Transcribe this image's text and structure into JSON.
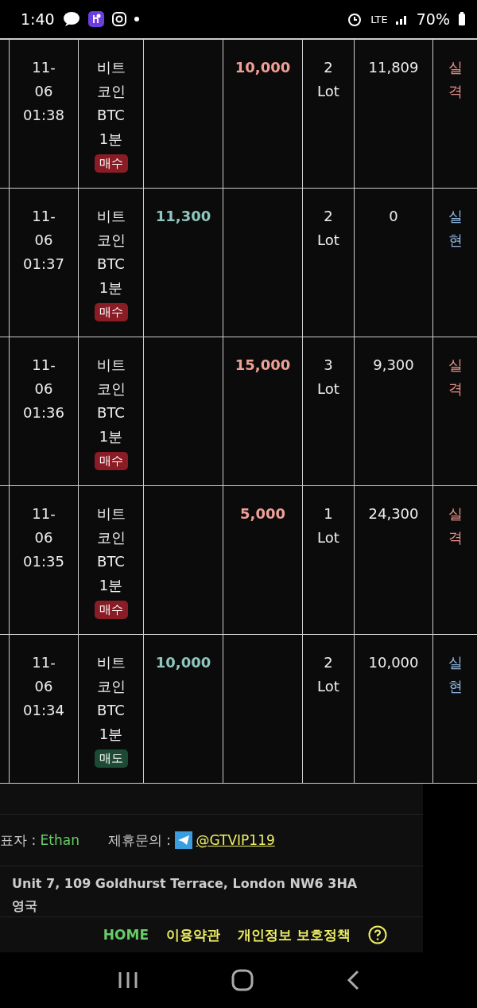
{
  "status_bar": {
    "time": "1:40",
    "network": "LTE",
    "battery": "70%"
  },
  "rows": [
    {
      "time": [
        "11-",
        "06",
        "01:38"
      ],
      "product": [
        "비트",
        "코인",
        "BTC",
        "1분"
      ],
      "side": {
        "kind": "buy",
        "label": "매수"
      },
      "profit": "",
      "loss": "10,000",
      "lots": [
        "2",
        "Lot"
      ],
      "amount": "11,809",
      "result": {
        "kind": "loss",
        "lines": [
          "실",
          "격"
        ]
      }
    },
    {
      "time": [
        "11-",
        "06",
        "01:37"
      ],
      "product": [
        "비트",
        "코인",
        "BTC",
        "1분"
      ],
      "side": {
        "kind": "buy",
        "label": "매수"
      },
      "profit": "11,300",
      "loss": "",
      "lots": [
        "2",
        "Lot"
      ],
      "amount": "0",
      "result": {
        "kind": "gain",
        "lines": [
          "실",
          "현"
        ]
      }
    },
    {
      "time": [
        "11-",
        "06",
        "01:36"
      ],
      "product": [
        "비트",
        "코인",
        "BTC",
        "1분"
      ],
      "side": {
        "kind": "buy",
        "label": "매수"
      },
      "profit": "",
      "loss": "15,000",
      "lots": [
        "3",
        "Lot"
      ],
      "amount": "9,300",
      "result": {
        "kind": "loss",
        "lines": [
          "실",
          "격"
        ]
      }
    },
    {
      "time": [
        "11-",
        "06",
        "01:35"
      ],
      "product": [
        "비트",
        "코인",
        "BTC",
        "1분"
      ],
      "side": {
        "kind": "buy",
        "label": "매수"
      },
      "profit": "",
      "loss": "5,000",
      "lots": [
        "1",
        "Lot"
      ],
      "amount": "24,300",
      "result": {
        "kind": "loss",
        "lines": [
          "실",
          "격"
        ]
      }
    },
    {
      "time": [
        "11-",
        "06",
        "01:34"
      ],
      "product": [
        "비트",
        "코인",
        "BTC",
        "1분"
      ],
      "side": {
        "kind": "sell",
        "label": "매도"
      },
      "profit": "10,000",
      "loss": "",
      "lots": [
        "2",
        "Lot"
      ],
      "amount": "10,000",
      "result": {
        "kind": "gain",
        "lines": [
          "실",
          "현"
        ]
      }
    }
  ],
  "footer": {
    "representative_label": "표자 : ",
    "representative": "Ethan",
    "contact_label": "제휴문의 : ",
    "contact": "@GTVIP119",
    "address": [
      "Unit 7, 109 Goldhurst Terrace, London NW6 3HA",
      "영국"
    ],
    "links": [
      {
        "label": "HOME",
        "kind": "home"
      },
      {
        "label": "이용약관",
        "kind": "link"
      },
      {
        "label": "개인정보 보호정책",
        "kind": "link"
      }
    ]
  }
}
